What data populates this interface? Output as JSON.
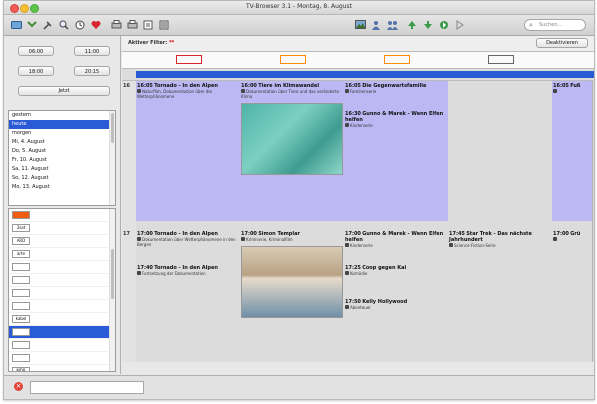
{
  "window": {
    "title": "TV-Browser 3.1 - Montag, 8. August"
  },
  "toolbar": {
    "icons": [
      "tv-icon",
      "scroll-icon",
      "tools-icon",
      "zoom-icon",
      "reminder-icon",
      "favorite-icon",
      "print-icon",
      "print-icon-2",
      "filter-icon",
      "list-icon"
    ],
    "right_icons": [
      "picture-icon",
      "person-icon",
      "person-group-icon",
      "arrow-up-icon",
      "arrow-down-icon",
      "arrow-right-icon",
      "arrow-forward-icon"
    ],
    "search_placeholder": "Suchen..."
  },
  "time_buttons": [
    "06:00",
    "11:00",
    "18:00",
    "20:15"
  ],
  "now_button": "Jetzt",
  "days": [
    "gestern",
    "heute",
    "morgen",
    "Mi, 4. August",
    "Do, 5. August",
    "Fr, 10. August",
    "Sa, 11. August",
    "So, 12. August",
    "Mo, 13. August"
  ],
  "selected_day_index": 1,
  "channels": [
    {
      "abbr": "",
      "color": "#f05c12"
    },
    {
      "abbr": "3sat",
      "color": "#ffffff"
    },
    {
      "abbr": "ARD",
      "color": "#ffffff"
    },
    {
      "abbr": "arte",
      "color": "#ffffff"
    },
    {
      "abbr": "",
      "color": "#ffffff"
    },
    {
      "abbr": "",
      "color": "#ffffff"
    },
    {
      "abbr": "",
      "color": "#ffffff"
    },
    {
      "abbr": "",
      "color": "#ffffff"
    },
    {
      "abbr": "kabel",
      "color": "#ffffff"
    },
    {
      "abbr": "",
      "color": "#2a5bd7"
    },
    {
      "abbr": "",
      "color": "#ffffff"
    },
    {
      "abbr": "",
      "color": "#ffffff"
    },
    {
      "abbr": "MDR",
      "color": "#ffffff"
    }
  ],
  "filter": {
    "label": "Aktiver Filter:",
    "value": "**",
    "deactivate": "Deaktivieren"
  },
  "channel_header_logos": [
    "",
    "",
    "",
    ""
  ],
  "hours": [
    "16",
    "17"
  ],
  "columns": [
    {
      "programs": [
        {
          "time": "16:05",
          "title": "Tornado - In den Alpen",
          "desc": "Naturfilm, Dokumentation über die Wetterphänomene",
          "band": true
        },
        {
          "time": "17:00",
          "title": "Tornado - In den Alpen",
          "desc": "Dokumentation über Wetterphänomene in den Bergen",
          "band": false
        },
        {
          "time": "17:40",
          "title": "Tornado - In den Alpen",
          "desc": "Fortsetzung der Dokumentation",
          "band": false
        }
      ]
    },
    {
      "programs": [
        {
          "time": "16:00",
          "title": "Tiere im Klimawandel",
          "desc": "Dokumentation über Tiere und das veränderte Klima",
          "band": true,
          "image": "teal"
        },
        {
          "time": "17:00",
          "title": "Simon Templar",
          "desc": "Krimiserie, Kriminalfilm",
          "band": false,
          "image": "people"
        }
      ]
    },
    {
      "programs": [
        {
          "time": "16:05",
          "title": "Die Gegenwartsfamilie",
          "desc": "Familienserie",
          "band": true
        },
        {
          "time": "16:30",
          "title": "Gunno & Marek - Wenn Elfen helfen",
          "desc": "Kinderserie",
          "band": true
        },
        {
          "time": "17:00",
          "title": "Gunno & Marek - Wenn Elfen helfen",
          "desc": "Kinderserie",
          "band": false
        },
        {
          "time": "17:25",
          "title": "Coop gegen Kai",
          "desc": "Komödie",
          "band": false
        },
        {
          "time": "17:50",
          "title": "Kelly Hollywood",
          "desc": "Abenteuer",
          "band": false
        }
      ]
    },
    {
      "programs": [
        {
          "time": "17:45",
          "title": "Star Trek - Das nächste Jahrhundert",
          "desc": "Science-Fiction-Serie",
          "band": false
        }
      ]
    },
    {
      "programs": [
        {
          "time": "16:05",
          "title": "Fuß",
          "desc": "",
          "band": true
        },
        {
          "time": "17:00",
          "title": "Grü",
          "desc": "",
          "band": false
        }
      ]
    }
  ],
  "colors": {
    "band": "#bcb8f3",
    "selection": "#2a5bd7",
    "channel_bar": "#2a5bd7"
  }
}
